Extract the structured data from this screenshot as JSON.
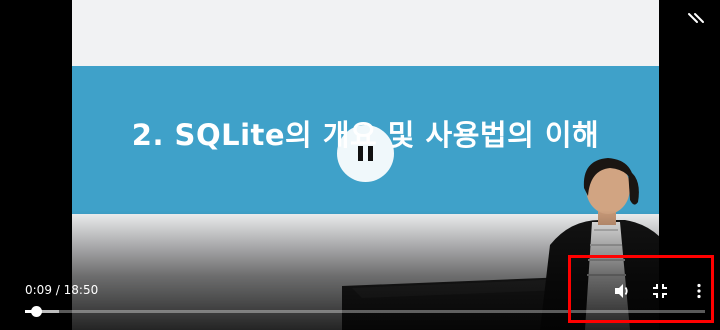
{
  "slide": {
    "title": "2. SQLite의 개요 및 사용법의 이해"
  },
  "player": {
    "current_time": "0:09",
    "separator": "/",
    "duration": "18:50",
    "played_fraction": 0.016,
    "buffered_fraction": 0.05,
    "center_button": "pause-icon",
    "top_right_icon": "collapse-icon",
    "controls": [
      "volume-icon",
      "exit-fullscreen-icon",
      "more-options-icon"
    ]
  },
  "colors": {
    "banner": "#3fa1c9",
    "highlight": "#ff0000"
  }
}
